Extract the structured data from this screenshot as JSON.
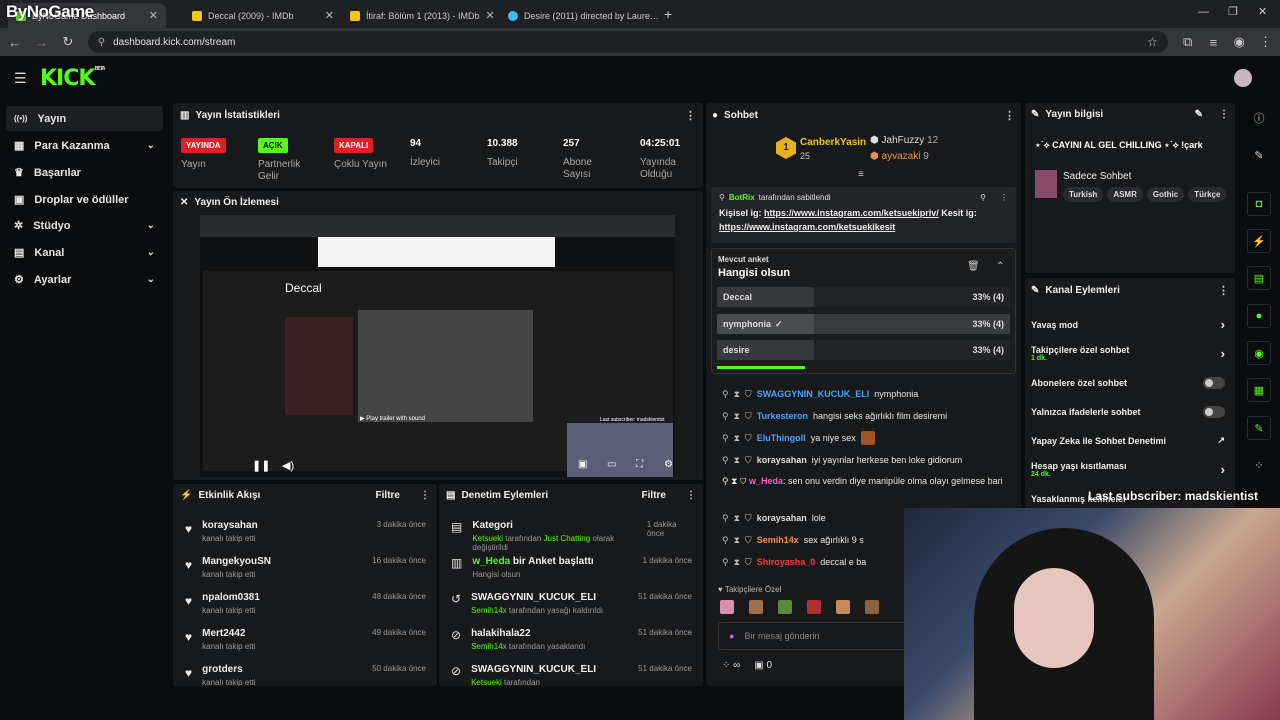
{
  "watermark": "ByNoGame",
  "browser": {
    "tabs": [
      {
        "title": "ByNoGame Dashboard",
        "fav": "#53fc18"
      },
      {
        "title": "Deccal (2009) - IMDb",
        "fav": "#f5c518"
      },
      {
        "title": "İtiraf: Bölüm 1 (2013) - IMDb",
        "fav": "#f5c518"
      },
      {
        "title": "Desire (2011) directed by Laure…",
        "fav": "#40bcf4"
      }
    ],
    "url": "dashboard.kick.com/stream"
  },
  "logo": {
    "text": "KICK",
    "beta": "BETA"
  },
  "sidebar": [
    {
      "label": "Yayın",
      "icon": "broadcast-icon",
      "glyph": "((•))"
    },
    {
      "label": "Para Kazanma",
      "icon": "money-icon",
      "glyph": "▦"
    },
    {
      "label": "Başarılar",
      "icon": "trophy-icon",
      "glyph": "🏆︎"
    },
    {
      "label": "Droplar ve ödüller",
      "icon": "gift-icon",
      "glyph": "▣"
    },
    {
      "label": "Stüdyo",
      "icon": "studio-icon",
      "glyph": "✲"
    },
    {
      "label": "Kanal",
      "icon": "channel-icon",
      "glyph": "▤"
    },
    {
      "label": "Ayarlar",
      "icon": "settings-icon",
      "glyph": "⚙"
    }
  ],
  "stats": {
    "title": "Yayın İstatistikleri",
    "items": [
      {
        "badge": "YAYINDA",
        "label": "Yayın"
      },
      {
        "badge": "AÇIK",
        "label": "Partnerlik Gelir"
      },
      {
        "badge": "KAPALI",
        "label": "Çoklu Yayın"
      },
      {
        "value": "94",
        "label": "İzleyici"
      },
      {
        "value": "10.388",
        "label": "Takipçi"
      },
      {
        "value": "257",
        "label": "Abone Sayısı"
      },
      {
        "value": "04:25:01",
        "label": "Yayında Olduğu"
      }
    ]
  },
  "preview": {
    "title": "Yayın Ön İzlemesi",
    "movie_title": "Deccal",
    "trailer_label": "Play trailer with sound",
    "last_sub_small": "Last subscriber: madskientist"
  },
  "activity": {
    "title": "Etkinlik Akışı",
    "filter": "Filtre",
    "items": [
      {
        "name": "koraysahan",
        "sub": "kanalı takip etti",
        "time": "3 dakika önce"
      },
      {
        "name": "MangekyouSN",
        "sub": "kanalı takip etti",
        "time": "16 dakika önce"
      },
      {
        "name": "npalom0381",
        "sub": "kanalı takip etti",
        "time": "48 dakika önce"
      },
      {
        "name": "Mert2442",
        "sub": "kanalı takip etti",
        "time": "49 dakika önce"
      },
      {
        "name": "grotders",
        "sub": "kanalı takip etti",
        "time": "50 dakika önce"
      }
    ]
  },
  "moderation": {
    "title": "Denetim Eylemleri",
    "filter": "Filtre",
    "items": [
      {
        "icon": "category-icon",
        "glyph": "▤",
        "name": "Kategori",
        "extra": "",
        "sub_a": "Ketsueki",
        "sub_b": " tarafından ",
        "sub_c": "Just Chatting",
        "sub_d": " olarak değiştirildi",
        "time": "1 dakika önce"
      },
      {
        "icon": "poll-icon",
        "glyph": "▥",
        "name": "w_Heda",
        "extra": " bir Anket başlattı",
        "sub_a": "",
        "sub_b": "Hangisi olsun",
        "sub_c": "",
        "sub_d": "",
        "time": "1 dakika önce"
      },
      {
        "icon": "unban-icon",
        "glyph": "↺",
        "name": "SWAGGYNIN_KUCUK_ELI",
        "extra": "",
        "sub_a": "Semih14x",
        "sub_b": " tarafından yasağı kaldırıldı",
        "sub_c": "",
        "sub_d": "",
        "time": "51 dakika önce"
      },
      {
        "icon": "ban-icon",
        "glyph": "⊘",
        "name": "halakihala22",
        "extra": "",
        "sub_a": "Semih14x",
        "sub_b": " tarafından yasaklandı",
        "sub_c": "",
        "sub_d": "",
        "time": "51 dakika önce"
      },
      {
        "icon": "ban-icon",
        "glyph": "⊘",
        "name": "SWAGGYNIN_KUCUK_ELI",
        "extra": "",
        "sub_a": "Ketsueki",
        "sub_b": " tarafından",
        "sub_c": "",
        "sub_d": "",
        "time": "51 dakika önce"
      }
    ]
  },
  "chat": {
    "title": "Sohbet",
    "top_gifters": [
      {
        "name": "CanberkYasin",
        "count": "25"
      },
      {
        "name": "JahFuzzy",
        "count": "12"
      },
      {
        "name": "ayvazaki",
        "count": "9"
      }
    ],
    "pinned_by": "BotRix",
    "pinned_suffix": "tarafından sabitlendi",
    "pinned_prefix1": "Kişisel ig: ",
    "pinned_link1": "https://www.instagram.com/ketsuekipriv/",
    "pinned_mid": " Kesit ig: ",
    "pinned_link2": "https://www.instagram.com/ketsuekikesit",
    "poll_label": "Mevcut anket",
    "poll_question": "Hangisi olsun",
    "poll_options": [
      {
        "label": "Deccal",
        "pct": "33% (4)",
        "fraction": 0.33
      },
      {
        "label": "nymphonia",
        "pct": "33% (4)",
        "fraction": 0.33
      },
      {
        "label": "desire",
        "pct": "33% (4)",
        "fraction": 0.33
      }
    ],
    "messages": [
      {
        "user": "SWAGGYNIN_KUCUK_ELI",
        "color": "#4aa3ff",
        "text": "nymphonia"
      },
      {
        "user": "Turkesteron",
        "color": "#4aa3ff",
        "text": "hangisi seks ağırlıklı film desiremi"
      },
      {
        "user": "EluThingoll",
        "color": "#4aa3ff",
        "text": "ya niye sex"
      },
      {
        "user": "koraysahan",
        "color": "#dddddd",
        "text": "iyi yayınlar herkese ben loke gidiorum"
      },
      {
        "user": "w_Heda",
        "color": "#ff5ac8",
        "text": "sen onu verdin diye manipüle olma olayı gelmese bari"
      },
      {
        "user": "koraysahan",
        "color": "#dddddd",
        "text": "lole"
      },
      {
        "user": "Semih14x",
        "color": "#ff8c42",
        "text": "sex ağırlıklı 9 s"
      },
      {
        "user": "Shiroyasha_0",
        "color": "#ff3b3b",
        "text": "deccal e ba"
      }
    ],
    "followers_only": "Takipçilere Özel",
    "input_placeholder": "Bir mesaj gönderin",
    "counter": "0"
  },
  "stream_info": {
    "title": "Yayın bilgisi",
    "stream_title": "⋆˙⟡ CAYINI AL GEL CHILLING ⋆˙⟡ !çark",
    "category": "Sadece Sohbet",
    "tags": [
      "Turkish",
      "ASMR",
      "Gothic",
      "Türkçe"
    ]
  },
  "channel_actions": {
    "title": "Kanal Eylemleri",
    "items": [
      {
        "label": "Yavaş mod",
        "sub": "",
        "control": "arrow"
      },
      {
        "label": "Takipçilere özel sohbet",
        "sub": "1 dk.",
        "control": "arrow"
      },
      {
        "label": "Abonelere özel sohbet",
        "sub": "",
        "control": "toggle"
      },
      {
        "label": "Yalnızca ifadelerle sohbet",
        "sub": "",
        "control": "toggle"
      },
      {
        "label": "Yapay Zeka ile Sohbet Denetimi",
        "sub": "",
        "control": "external"
      },
      {
        "label": "Hesap yaşı kısıtlaması",
        "sub": "24 dk.",
        "control": "arrow"
      },
      {
        "label": "Yasaklanmış kelimeler",
        "sub": "",
        "control": "arrow"
      }
    ]
  },
  "overlay_last_sub": "Last subscriber: madskientist",
  "colors": {
    "accent": "#53fc18",
    "live": "#e01e26"
  }
}
